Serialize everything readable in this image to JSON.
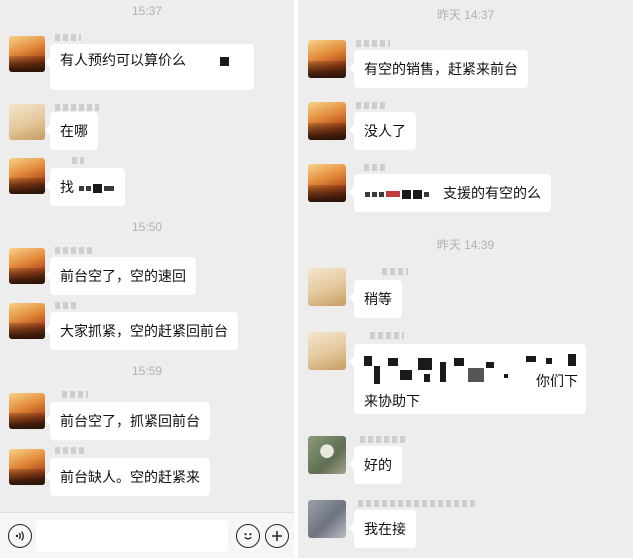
{
  "left": {
    "timestamps": [
      "15:37",
      "15:50",
      "15:59"
    ],
    "messages": [
      {
        "text": "有人预约可以算价么"
      },
      {
        "text": "在哪"
      },
      {
        "text": "找"
      },
      {
        "text": "前台空了，空的速回"
      },
      {
        "text": "大家抓紧，空的赶紧回前台"
      },
      {
        "text": "前台空了，抓紧回前台"
      },
      {
        "text": "前台缺人。空的赶紧来"
      }
    ],
    "input_bar": {
      "voice_icon": "voice-icon",
      "emoji_icon": "emoji-icon",
      "plus_icon": "plus-icon",
      "input_value": ""
    }
  },
  "right": {
    "timestamps": [
      "昨天 14:37",
      "昨天 14:39"
    ],
    "messages": [
      {
        "text": "有空的销售，赶紧来前台"
      },
      {
        "text": "没人了"
      },
      {
        "text": "支援的有空的么"
      },
      {
        "text": "稍等"
      },
      {
        "text_line1": "你们下",
        "text_line2": "来协助下"
      },
      {
        "text": "好的"
      },
      {
        "text": "我在接"
      }
    ]
  },
  "colors": {
    "chat_background": "#ededed",
    "bubble": "#ffffff",
    "timestamp_text": "#b2b2b2"
  }
}
